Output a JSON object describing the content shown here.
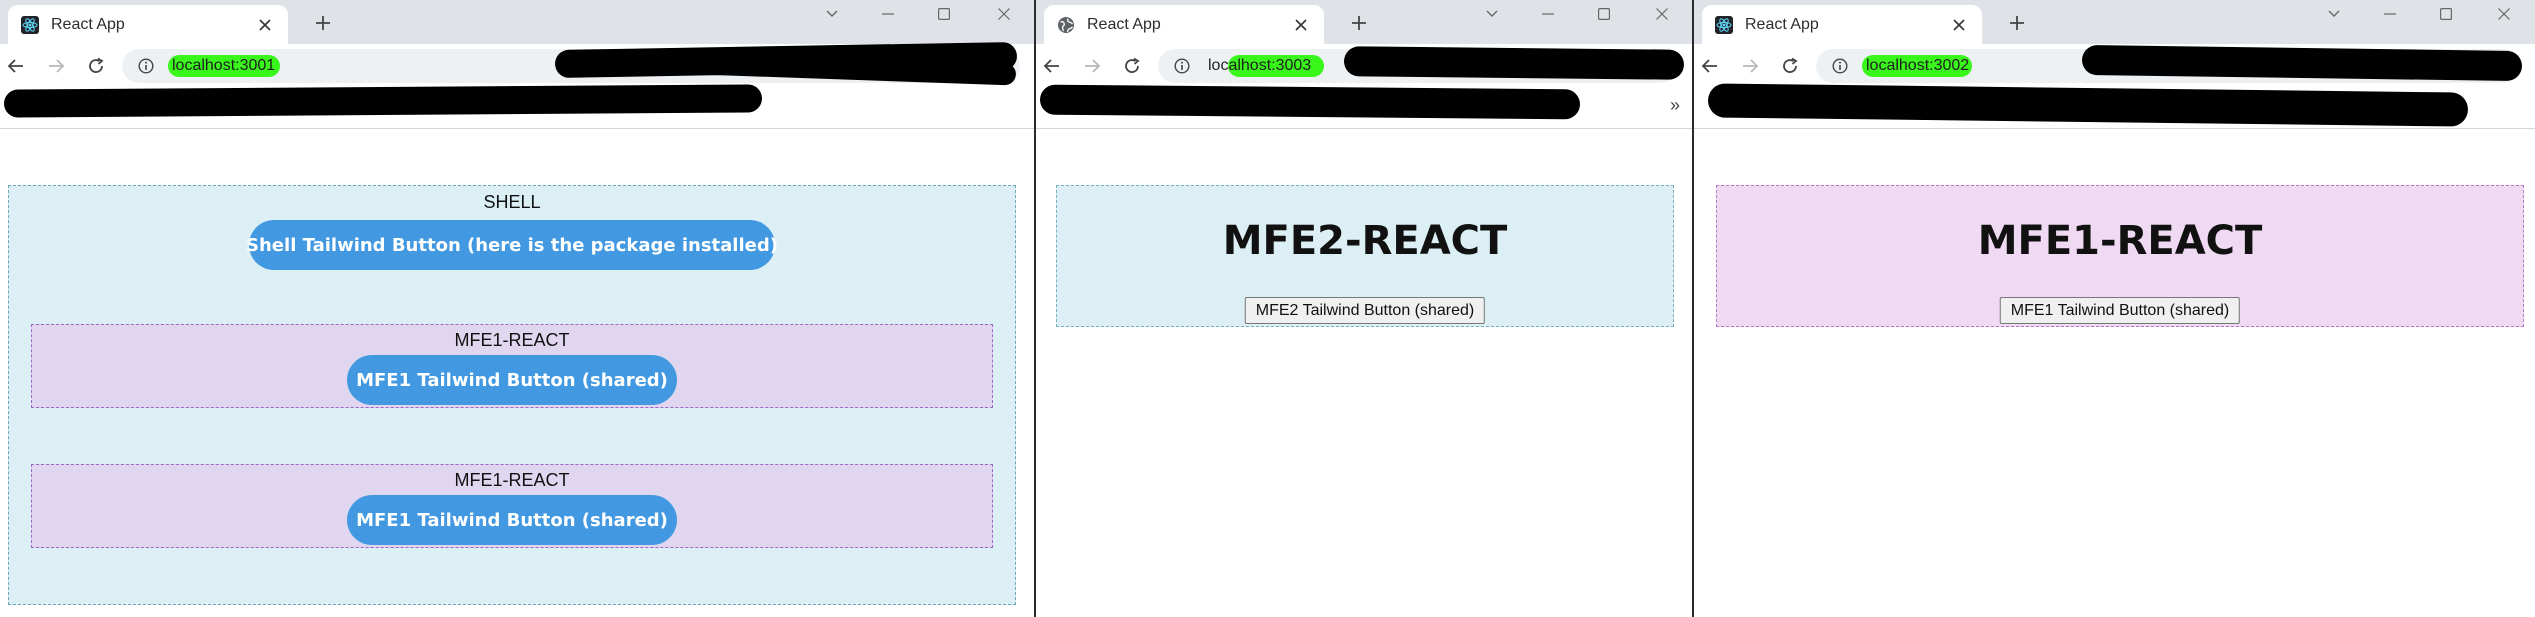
{
  "windows": [
    {
      "tab_title": "React App",
      "tab_icon": "react-icon",
      "url": "localhost:3001",
      "app": {
        "shell_label": "SHELL",
        "shell_button": "Shell Tailwind Button (here is the package installed)",
        "nested": [
          {
            "label": "MFE1-REACT",
            "button": "MFE1 Tailwind Button (shared)"
          },
          {
            "label": "MFE1-REACT",
            "button": "MFE1 Tailwind Button (shared)"
          }
        ]
      }
    },
    {
      "tab_title": "React App",
      "tab_icon": "globe-icon",
      "url": "localhost:3003",
      "bookmarks_overflow": "»",
      "app": {
        "title": "MFE2-REACT",
        "button": "MFE2 Tailwind Button (shared)"
      }
    },
    {
      "tab_title": "React App",
      "tab_icon": "react-icon",
      "url": "localhost:3002",
      "app": {
        "title": "MFE1-REACT",
        "button": "MFE1 Tailwind Button (shared)"
      }
    }
  ],
  "colors": {
    "tailwind_button": "#4299e1",
    "shell_bg": "#dbeff5",
    "mfe1_nested_bg": "#e0d6f0",
    "mfe1_standalone_bg": "#f0d9f2",
    "url_highlight": "#2ef50f",
    "redaction": "#000000"
  }
}
